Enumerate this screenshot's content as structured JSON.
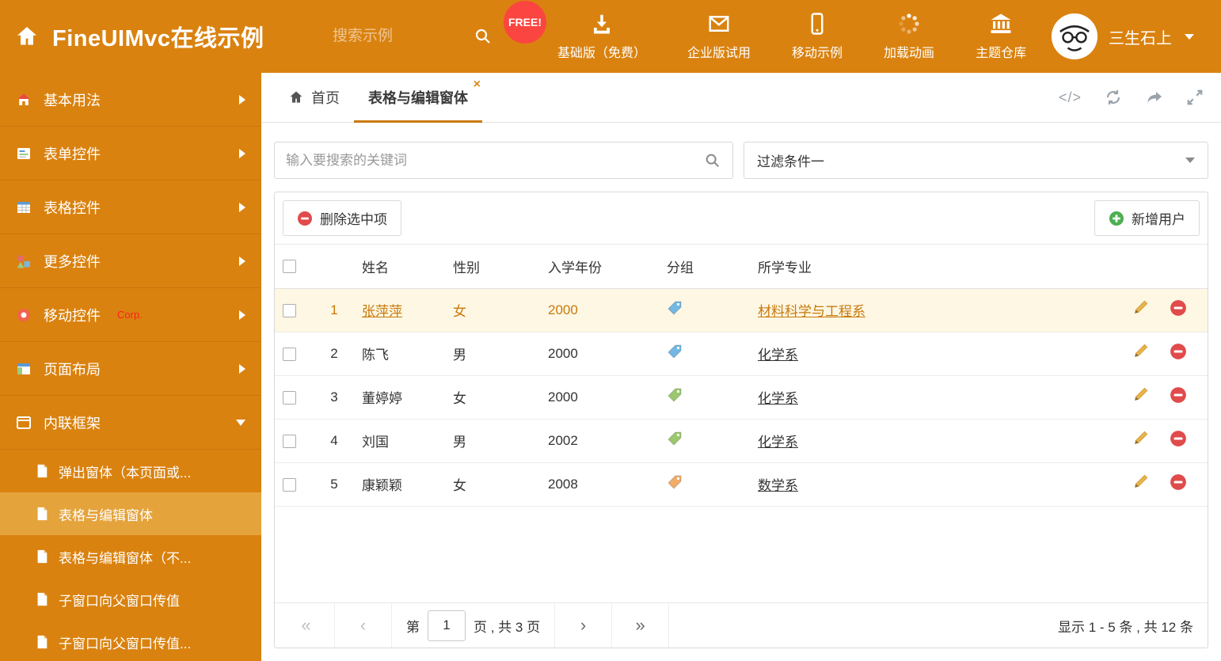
{
  "colors": {
    "brand_orange": "#da820f",
    "accent": "#c8790b",
    "sidebar_active": "#e5a33c",
    "selected_row_bg": "#fdf7e3",
    "free_badge_red": "#fb4540",
    "delete_red": "#e04b4b",
    "add_green": "#4caf50",
    "pencil_orange": "#e2a23b"
  },
  "icons": {
    "close": "×",
    "code": "</>",
    "first": "«",
    "prev": "‹",
    "next": "›",
    "last": "»"
  },
  "header": {
    "title": "FineUIMvc在线示例",
    "search_placeholder": "搜索示例",
    "free_badge": "FREE!",
    "nav": [
      {
        "label": "基础版（免费）"
      },
      {
        "label": "企业版试用"
      },
      {
        "label": "移动示例"
      },
      {
        "label": "加载动画"
      },
      {
        "label": "主题仓库"
      }
    ],
    "user_name": "三生石上"
  },
  "sidebar": {
    "items": [
      {
        "label": "基本用法"
      },
      {
        "label": "表单控件"
      },
      {
        "label": "表格控件"
      },
      {
        "label": "更多控件"
      },
      {
        "label": "移动控件",
        "badge": "Corp."
      },
      {
        "label": "页面布局"
      },
      {
        "label": "内联框架"
      }
    ],
    "subitems": [
      {
        "label": "弹出窗体（本页面或..."
      },
      {
        "label": "表格与编辑窗体"
      },
      {
        "label": "表格与编辑窗体（不..."
      },
      {
        "label": "子窗口向父窗口传值"
      },
      {
        "label": "子窗口向父窗口传值..."
      }
    ]
  },
  "tabs": {
    "home_label": "首页",
    "active_label": "表格与编辑窗体"
  },
  "filter": {
    "search_placeholder": "输入要搜索的关键词",
    "dropdown_value": "过滤条件一"
  },
  "toolbar": {
    "delete_label": "删除选中项",
    "add_label": "新增用户"
  },
  "table": {
    "headers": [
      "姓名",
      "性别",
      "入学年份",
      "分组",
      "所学专业"
    ],
    "rows": [
      {
        "index": "1",
        "name": "张萍萍",
        "gender": "女",
        "year": "2000",
        "tag_color": "#72b8e4",
        "major": "材料科学与工程系"
      },
      {
        "index": "2",
        "name": "陈飞",
        "gender": "男",
        "year": "2000",
        "tag_color": "#72b8e4",
        "major": "化学系"
      },
      {
        "index": "3",
        "name": "董婷婷",
        "gender": "女",
        "year": "2000",
        "tag_color": "#9bc86e",
        "major": "化学系"
      },
      {
        "index": "4",
        "name": "刘国",
        "gender": "男",
        "year": "2002",
        "tag_color": "#9bc86e",
        "major": "化学系"
      },
      {
        "index": "5",
        "name": "康颖颖",
        "gender": "女",
        "year": "2008",
        "tag_color": "#f0ad6a",
        "major": "数学系"
      }
    ]
  },
  "pagination": {
    "page_prefix": "第",
    "current_page": "1",
    "page_suffix": "页 , 共 3 页",
    "summary": "显示 1 - 5 条 , 共 12 条"
  }
}
